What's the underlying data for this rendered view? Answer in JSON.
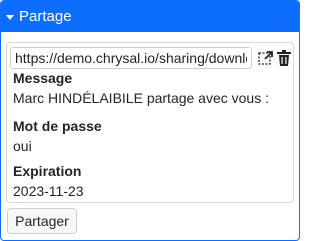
{
  "panel": {
    "title": "Partage",
    "accent_color": "#0d6efd",
    "collapse_icon": "caret-down-icon"
  },
  "share_link": {
    "url": "https://demo.chrysal.io/sharing/download/",
    "open_icon": "external-link-icon",
    "delete_icon": "trash-icon"
  },
  "fields": {
    "message_label": "Message",
    "message_value": "Marc HINDÉLAIBILE partage avec vous :",
    "password_label": "Mot de passe",
    "password_value": "oui",
    "expiration_label": "Expiration",
    "expiration_value": "2023-11-23"
  },
  "actions": {
    "share_label": "Partager"
  }
}
